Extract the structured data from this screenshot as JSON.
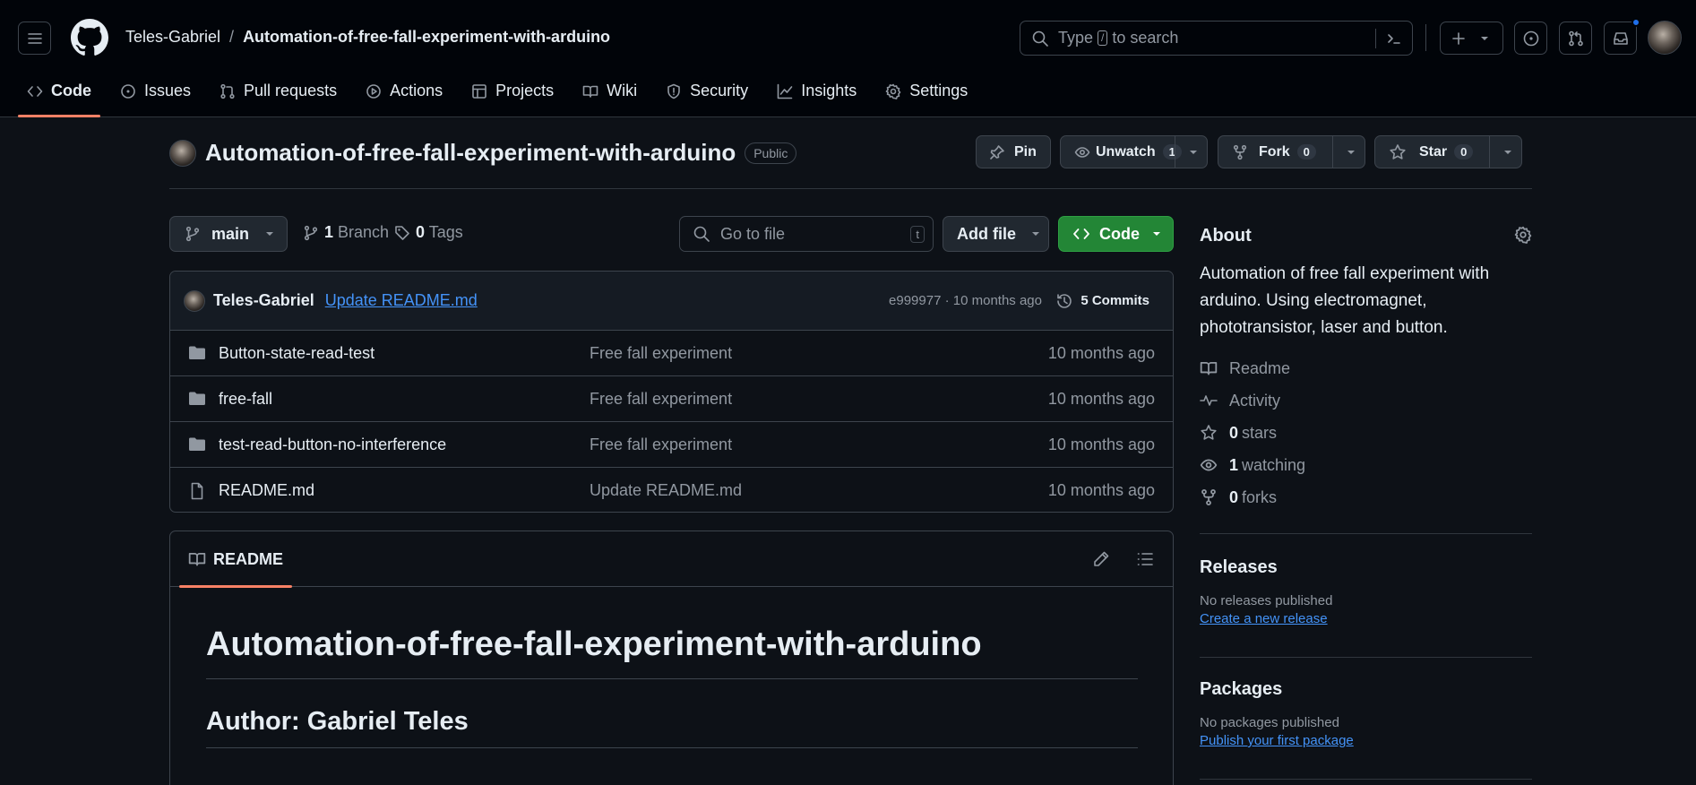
{
  "header": {
    "owner": "Teles-Gabriel",
    "separator": "/",
    "repo": "Automation-of-free-fall-experiment-with-arduino",
    "search_pre": "Type",
    "search_key": "/",
    "search_post": "to search"
  },
  "nav": {
    "tabs": [
      {
        "label": "Code",
        "icon": "code-icon"
      },
      {
        "label": "Issues",
        "icon": "issue-icon"
      },
      {
        "label": "Pull requests",
        "icon": "pull-request-icon"
      },
      {
        "label": "Actions",
        "icon": "play-icon"
      },
      {
        "label": "Projects",
        "icon": "table-icon"
      },
      {
        "label": "Wiki",
        "icon": "book-icon"
      },
      {
        "label": "Security",
        "icon": "shield-icon"
      },
      {
        "label": "Insights",
        "icon": "graph-icon"
      },
      {
        "label": "Settings",
        "icon": "gear-icon"
      }
    ]
  },
  "repo_header": {
    "name": "Automation-of-free-fall-experiment-with-arduino",
    "visibility": "Public",
    "pin": "Pin",
    "unwatch": "Unwatch",
    "unwatch_count": "1",
    "fork": "Fork",
    "fork_count": "0",
    "star": "Star",
    "star_count": "0"
  },
  "toolbar": {
    "branch": "main",
    "branches_num": "1",
    "branches_label": "Branch",
    "tags_num": "0",
    "tags_label": "Tags",
    "goto_placeholder": "Go to file",
    "goto_key": "t",
    "add_file": "Add file",
    "code": "Code"
  },
  "commit": {
    "author": "Teles-Gabriel",
    "message": "Update README.md",
    "hash_time": "e999977 · 10 months ago",
    "commits": "5 Commits"
  },
  "files": [
    {
      "name": "Button-state-read-test",
      "type": "folder",
      "message": "Free fall experiment",
      "time": "10 months ago"
    },
    {
      "name": "free-fall",
      "type": "folder",
      "message": "Free fall experiment",
      "time": "10 months ago"
    },
    {
      "name": "test-read-button-no-interference",
      "type": "folder",
      "message": "Free fall experiment",
      "time": "10 months ago"
    },
    {
      "name": "README.md",
      "type": "file",
      "message": "Update README.md",
      "time": "10 months ago"
    }
  ],
  "readme": {
    "tab": "README",
    "h1": "Automation-of-free-fall-experiment-with-arduino",
    "h2": "Author: Gabriel Teles"
  },
  "about": {
    "title": "About",
    "description": "Automation of free fall experiment with arduino. Using electromagnet, phototransistor, laser and button.",
    "readme": "Readme",
    "activity": "Activity",
    "stars_num": "0",
    "stars_label": "stars",
    "watching_num": "1",
    "watching_label": "watching",
    "forks_num": "0",
    "forks_label": "forks"
  },
  "releases": {
    "title": "Releases",
    "text": "No releases published",
    "link": "Create a new release"
  },
  "packages": {
    "title": "Packages",
    "text": "No packages published",
    "link": "Publish your first package"
  },
  "colors": {
    "background": "#0d1117",
    "header_bg": "#010409",
    "accent_underline": "#f78166",
    "link": "#4493f8",
    "primary_button": "#238636",
    "notification_dot": "#1f6feb"
  }
}
